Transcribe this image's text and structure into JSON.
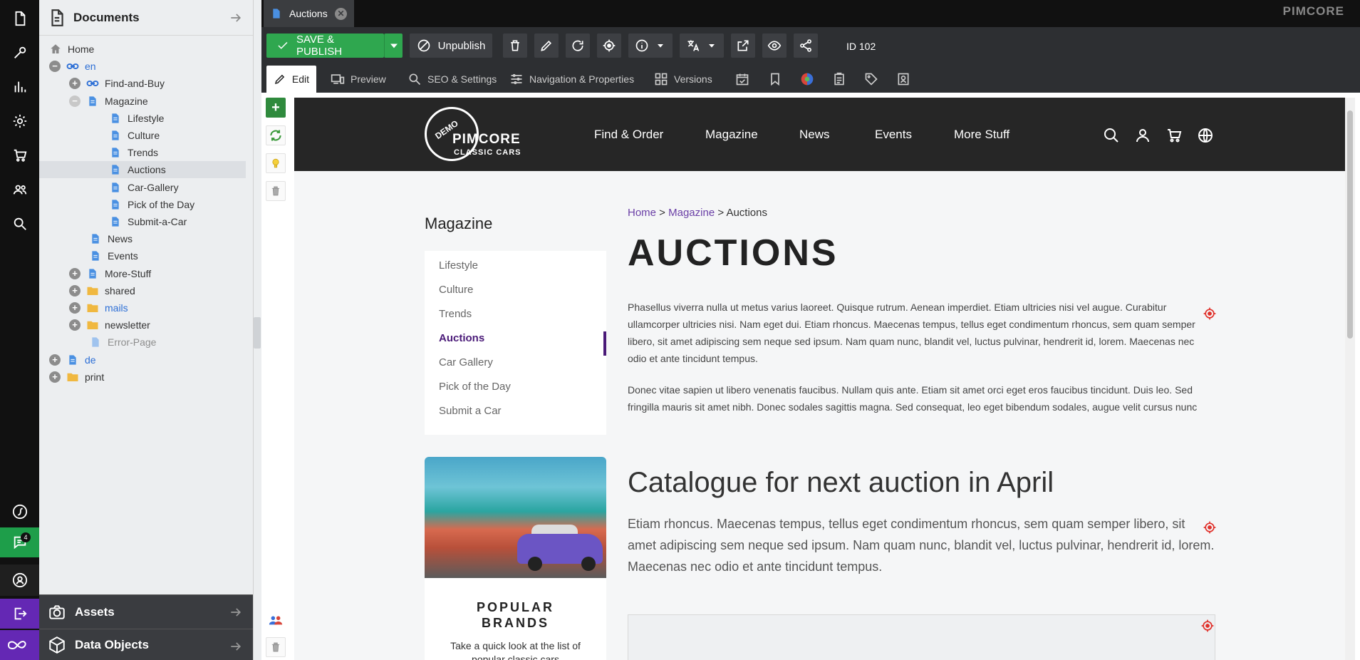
{
  "tree": {
    "title": "Documents",
    "nodes": [
      {
        "label": "Home"
      },
      {
        "label": "en"
      },
      {
        "label": "Find-and-Buy"
      },
      {
        "label": "Magazine"
      },
      {
        "label": "Lifestyle"
      },
      {
        "label": "Culture"
      },
      {
        "label": "Trends"
      },
      {
        "label": "Auctions"
      },
      {
        "label": "Car-Gallery"
      },
      {
        "label": "Pick of the Day"
      },
      {
        "label": "Submit-a-Car"
      },
      {
        "label": "News"
      },
      {
        "label": "Events"
      },
      {
        "label": "More-Stuff"
      },
      {
        "label": "shared"
      },
      {
        "label": "mails"
      },
      {
        "label": "newsletter"
      },
      {
        "label": "Error-Page"
      },
      {
        "label": "de"
      },
      {
        "label": "print"
      }
    ]
  },
  "accordions": {
    "assets": "Assets",
    "data_objects": "Data Objects"
  },
  "notifications": {
    "count": "4"
  },
  "tab": {
    "label": "Auctions"
  },
  "brand": "PIMCORE",
  "toolbar": {
    "save_label": "SAVE & PUBLISH",
    "unpublish_label": "Unpublish",
    "id_label": "ID 102"
  },
  "edit_tabs": {
    "edit": "Edit",
    "preview": "Preview",
    "seo": "SEO & Settings",
    "nav": "Navigation & Properties",
    "versions": "Versions"
  },
  "site": {
    "logo_badge": "DEMO",
    "logo_text": "PIMCORE",
    "logo_sub": "CLASSIC CARS",
    "nav": [
      "Find & Order",
      "Magazine",
      "News",
      "Events",
      "More Stuff"
    ],
    "sidebar_title": "Magazine",
    "sidebar_items": [
      "Lifestyle",
      "Culture",
      "Trends",
      "Auctions",
      "Car Gallery",
      "Pick of the Day",
      "Submit a Car"
    ],
    "card_title_1": "POPULAR",
    "card_title_2": "BRANDS",
    "card_text": "Take a quick look at the list of popular classic cars",
    "breadcrumb": {
      "home": "Home",
      "sep1": " > ",
      "magazine": "Magazine",
      "sep2": " > ",
      "current": "Auctions"
    },
    "heading": "AUCTIONS",
    "para1": "Phasellus viverra nulla ut metus varius laoreet. Quisque rutrum. Aenean imperdiet. Etiam ultricies nisi vel augue. Curabitur ullamcorper ultricies nisi. Nam eget dui. Etiam rhoncus. Maecenas tempus, tellus eget condimentum rhoncus, sem quam semper libero, sit amet adipiscing sem neque sed ipsum. Nam quam nunc, blandit vel, luctus pulvinar, hendrerit id, lorem. Maecenas nec odio et ante tincidunt tempus.",
    "para2": "Donec vitae sapien ut libero venenatis faucibus. Nullam quis ante. Etiam sit amet orci eget eros faucibus tincidunt. Duis leo. Sed fringilla mauris sit amet nibh. Donec sodales sagittis magna. Sed consequat, leo eget bibendum sodales, augue velit cursus nunc",
    "subheading": "Catalogue for next auction in April",
    "lead": "Etiam rhoncus. Maecenas tempus, tellus eget condimentum rhoncus, sem quam semper libero, sit amet adipiscing sem neque sed ipsum. Nam quam nunc, blandit vel, luctus pulvinar, hendrerit id, lorem. Maecenas nec odio et ante tincidunt tempus."
  },
  "colors": {
    "save_green": "#2fa74f",
    "accent_purple": "#4a1a78",
    "link_blue": "#2d6fd6",
    "target_red": "#e0302a"
  }
}
